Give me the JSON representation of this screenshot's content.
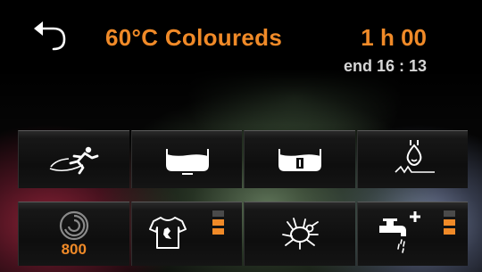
{
  "header": {
    "program_title": "60°C Coloureds",
    "duration": "1 h 00",
    "end_time": "end 16 : 13"
  },
  "option_row": {
    "buttons": [
      {
        "name": "speed-option",
        "icon": "running-person-icon"
      },
      {
        "name": "water-level-option",
        "icon": "basin-low-water-icon"
      },
      {
        "name": "rinse-hold-option",
        "icon": "basin-stop-icon"
      },
      {
        "name": "steam-option",
        "icon": "steam-drop-icon"
      }
    ]
  },
  "setting_row": {
    "spin": {
      "icon": "spin-swirl-icon",
      "value": "800"
    },
    "soil_level": {
      "icon": "shirt-stain-icon",
      "level": 2,
      "max": 3
    },
    "anti_allergy": {
      "icon": "dust-mite-icon"
    },
    "extra_rinse": {
      "icon": "tap-plus-icon",
      "level": 2,
      "max": 3
    }
  },
  "colors": {
    "accent": "#f08a28",
    "text_light": "#d6d6d6",
    "bar_off": "#4a4a4a"
  }
}
